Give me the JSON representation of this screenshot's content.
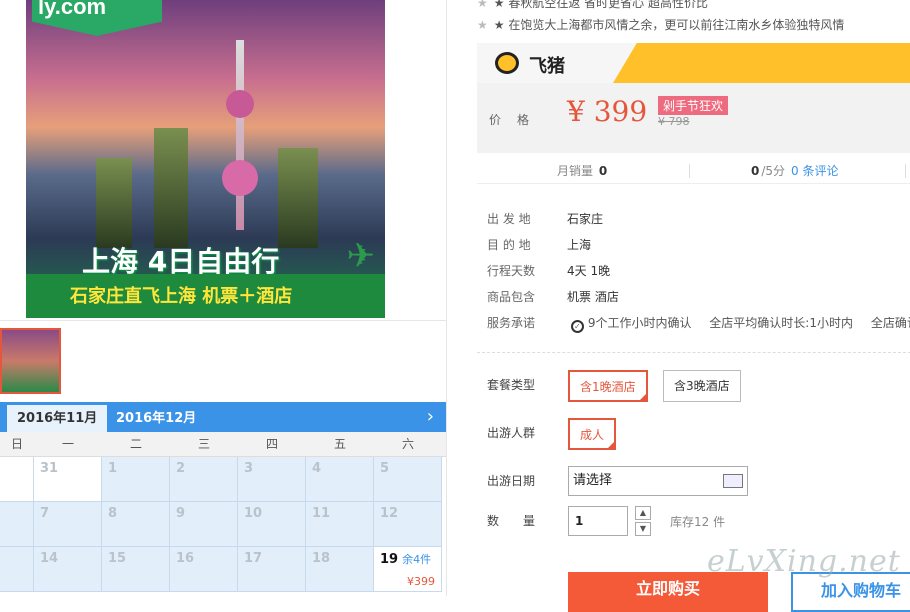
{
  "poster": {
    "logo": "ly.com",
    "title": "上海 4日自由行",
    "subtitle": "石家庄直飞上海 机票＋酒店"
  },
  "features": [
    "★ 春秋航空往返 省时更省心 超高性价比",
    "★ 在饱览大上海都市风情之余，更可以前往江南水乡体验独特风情"
  ],
  "brand": {
    "name": "飞猪"
  },
  "price": {
    "label": "价格",
    "currency": "¥",
    "value": "399",
    "promo": "剁手节狂欢",
    "original": "¥ 798"
  },
  "stats": {
    "sales_label": "月销量",
    "sales_value": "0",
    "rating_value": "0",
    "rating_suffix": "/5分",
    "reviews": "0 条评论"
  },
  "info": [
    {
      "key": "出 发 地",
      "value": "石家庄"
    },
    {
      "key": "目 的 地",
      "value": "上海"
    },
    {
      "key": "行程天数",
      "value": "4天 1晚"
    },
    {
      "key": "商品包含",
      "value": "机票  酒店"
    }
  ],
  "promise": {
    "key": "服务承诺",
    "items": [
      "9个工作小时内确认",
      "全店平均确认时长:1小时内",
      "全店确认速"
    ]
  },
  "options": {
    "package_label": "套餐类型",
    "package_choices": [
      "含1晚酒店",
      "含3晚酒店"
    ],
    "group_label": "出游人群",
    "group_choice": "成人",
    "date_label": "出游日期",
    "date_placeholder": "请选择",
    "qty_label": "数　　量",
    "qty_value": "1",
    "stock": "库存12 件"
  },
  "actions": {
    "buy": "立即购买",
    "cart": "加入购物车"
  },
  "calendar": {
    "month_active": "2016年11月",
    "month_next": "2016年12月",
    "weekdays": [
      "日",
      "一",
      "二",
      "三",
      "四",
      "五",
      "六"
    ],
    "rows": [
      [
        "",
        "31",
        "1",
        "2",
        "3",
        "4",
        "5"
      ],
      [
        "",
        "7",
        "8",
        "9",
        "10",
        "11",
        "12"
      ],
      [
        "",
        "14",
        "15",
        "16",
        "17",
        "18",
        "19"
      ]
    ],
    "avail_stock": "余4件",
    "avail_price": "¥399"
  },
  "watermark": "eLvXing.net",
  "colors": {
    "accent": "#e4573d",
    "blue": "#3b93e8",
    "fliggy": "#ffc02a"
  }
}
